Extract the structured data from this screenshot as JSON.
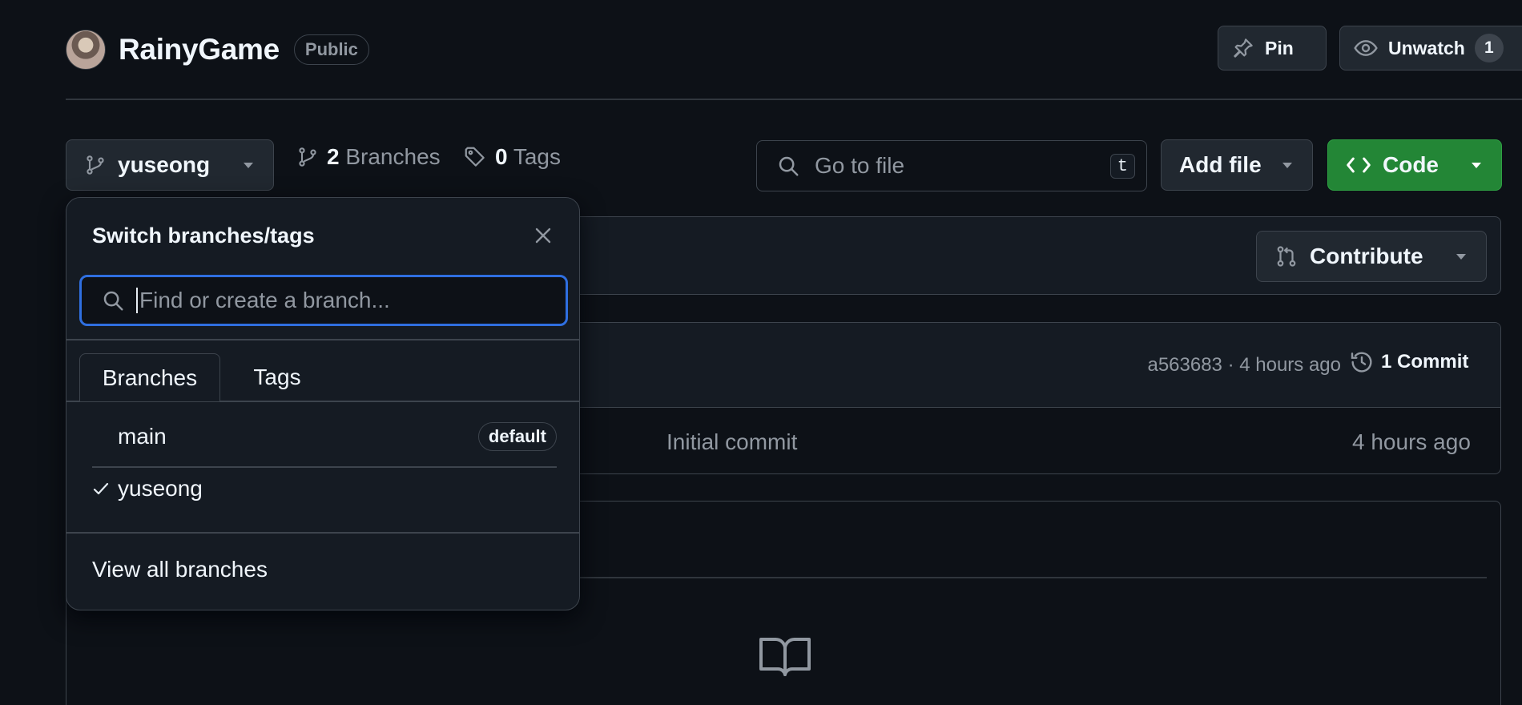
{
  "repo": {
    "name": "RainyGame",
    "visibility": "Public"
  },
  "header_actions": {
    "pin_label": "Pin",
    "unwatch_label": "Unwatch",
    "watch_count": "1"
  },
  "toolbar": {
    "current_branch": "yuseong",
    "branches_count": "2",
    "branches_label": "Branches",
    "tags_count": "0",
    "tags_label": "Tags",
    "go_to_file_placeholder": "Go to file",
    "go_to_file_shortcut": "t",
    "add_file_label": "Add file",
    "code_label": "Code"
  },
  "contribute_label": "Contribute",
  "latest_commit": {
    "hash": "a563683",
    "time": "4 hours ago",
    "commits_label": "1 Commit"
  },
  "file_row": {
    "message": "Initial commit",
    "time": "4 hours ago"
  },
  "branch_dropdown": {
    "title": "Switch branches/tags",
    "search_placeholder": "Find or create a branch...",
    "tabs": [
      "Branches",
      "Tags"
    ],
    "active_tab": "Branches",
    "branches": [
      {
        "name": "main",
        "badge": "default",
        "selected": false
      },
      {
        "name": "yuseong",
        "badge": "",
        "selected": true
      }
    ],
    "view_all_label": "View all branches"
  },
  "colors": {
    "background": "#0d1117",
    "panel": "#151b23",
    "border": "#3d444d",
    "accent_focus": "#2f6fe0",
    "code_button": "#238636"
  }
}
